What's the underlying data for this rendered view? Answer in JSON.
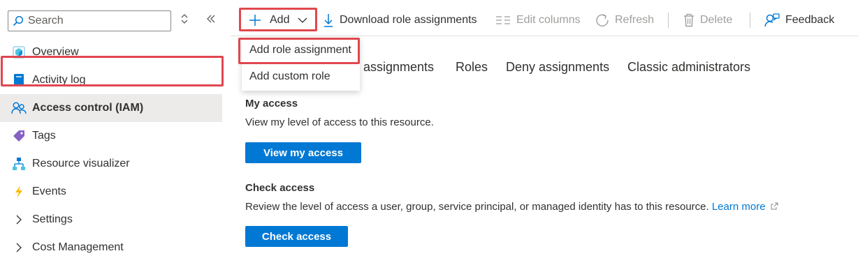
{
  "sidebar": {
    "search_placeholder": "Search",
    "items": [
      {
        "label": "Overview",
        "icon": "overview-icon"
      },
      {
        "label": "Activity log",
        "icon": "activity-log-icon"
      },
      {
        "label": "Access control (IAM)",
        "icon": "people-icon",
        "active": true
      },
      {
        "label": "Tags",
        "icon": "tag-icon"
      },
      {
        "label": "Resource visualizer",
        "icon": "hierarchy-icon"
      },
      {
        "label": "Events",
        "icon": "lightning-icon"
      },
      {
        "label": "Settings",
        "icon": "chevron-right-icon"
      },
      {
        "label": "Cost Management",
        "icon": "chevron-right-icon"
      }
    ]
  },
  "toolbar": {
    "add": "Add",
    "download": "Download role assignments",
    "edit_columns": "Edit columns",
    "refresh": "Refresh",
    "delete": "Delete",
    "feedback": "Feedback"
  },
  "tabs": {
    "role_assignments_partial": "e assignments",
    "roles": "Roles",
    "deny": "Deny assignments",
    "classic": "Classic administrators"
  },
  "dropdown": {
    "items": [
      "Add role assignment",
      "Add custom role"
    ]
  },
  "my_access": {
    "title": "My access",
    "description": "View my level of access to this resource.",
    "button": "View my access"
  },
  "check_access": {
    "title": "Check access",
    "description": "Review the level of access a user, group, service principal, or managed identity has to this resource.",
    "learn_more": "Learn more",
    "button": "Check access"
  },
  "colors": {
    "accent": "#0078d4",
    "highlight": "#e0474f"
  }
}
